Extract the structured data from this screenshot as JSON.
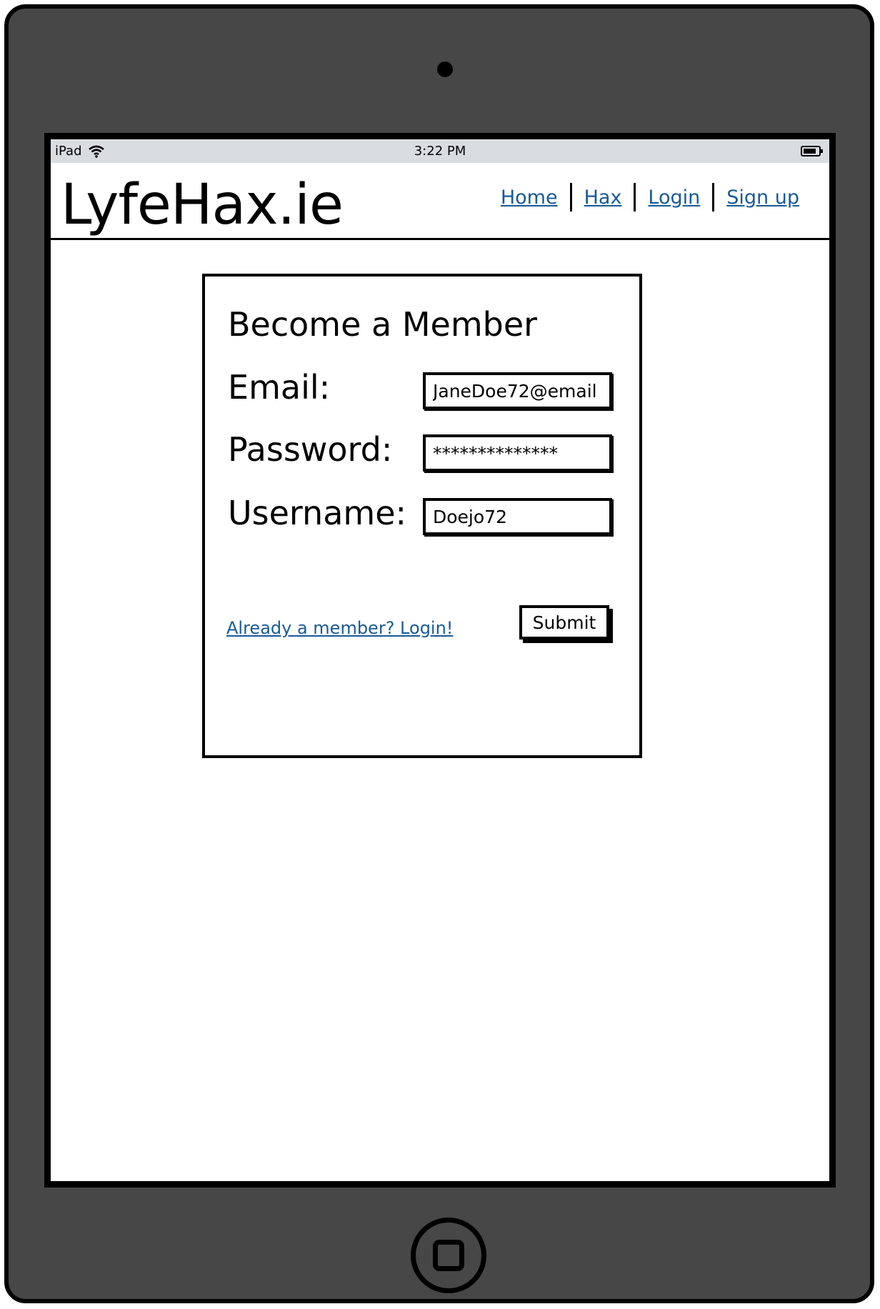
{
  "status_bar": {
    "device": "iPad",
    "time": "3:22 PM"
  },
  "header": {
    "logo": "LyfeHax.ie",
    "nav": {
      "home": "Home",
      "hax": "Hax",
      "login": "Login",
      "signup": "Sign up"
    }
  },
  "form": {
    "title": "Become a Member",
    "email_label": "Email:",
    "email_value": "JaneDoe72@email",
    "password_label": "Password:",
    "password_value": "**************",
    "username_label": "Username:",
    "username_value": "Doejo72",
    "login_link": "Already a member? Login!",
    "submit_label": "Submit"
  },
  "colors": {
    "link": "#1a5a96",
    "device_frame": "#474747",
    "status_bar": "#d9dde0"
  }
}
